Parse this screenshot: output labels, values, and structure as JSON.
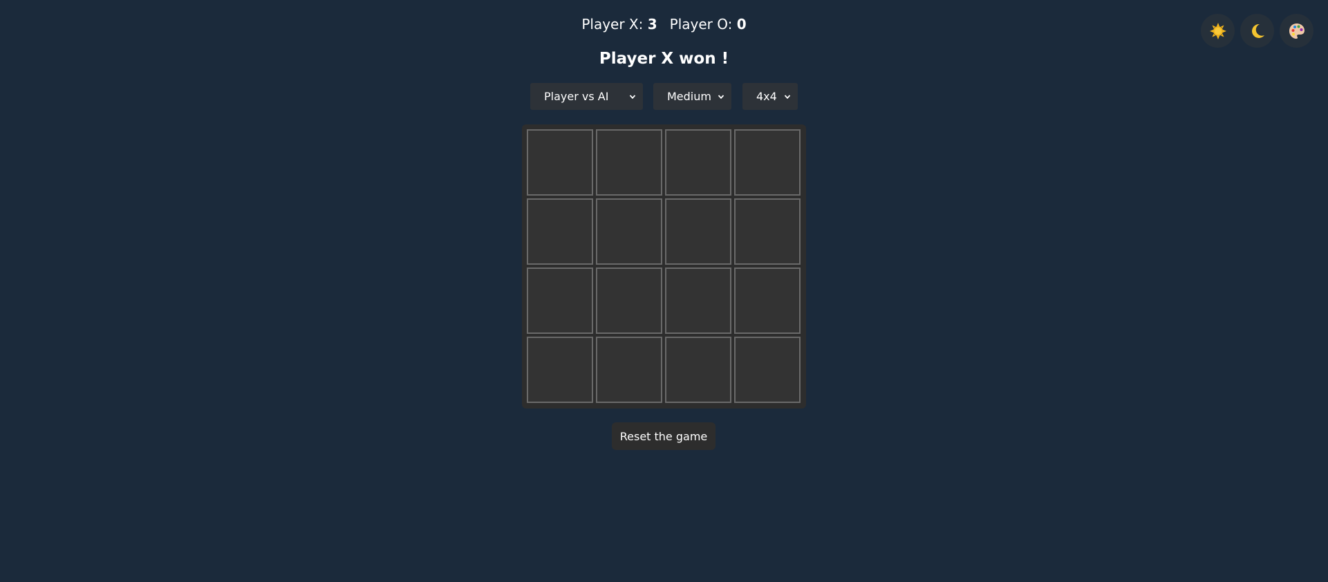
{
  "scoreboard": {
    "player_x_label": "Player X:",
    "player_x_score": "3",
    "player_o_label": "Player O:",
    "player_o_score": "0"
  },
  "status": "Player X won !",
  "controls": {
    "mode": "Player vs AI",
    "difficulty": "Medium",
    "board_size": "4x4"
  },
  "board": {
    "cells": [
      "",
      "",
      "",
      "",
      "",
      "",
      "",
      "",
      "",
      "",
      "",
      "",
      "",
      "",
      "",
      ""
    ]
  },
  "reset_label": "Reset the game",
  "theme_buttons": [
    {
      "icon": "sun-icon"
    },
    {
      "icon": "moon-icon"
    },
    {
      "icon": "palette-icon"
    }
  ],
  "colors": {
    "background": "#1b2a3b",
    "board": "#2d2d2d",
    "cell": "#333333",
    "cell_border": "#6a6a6a"
  }
}
